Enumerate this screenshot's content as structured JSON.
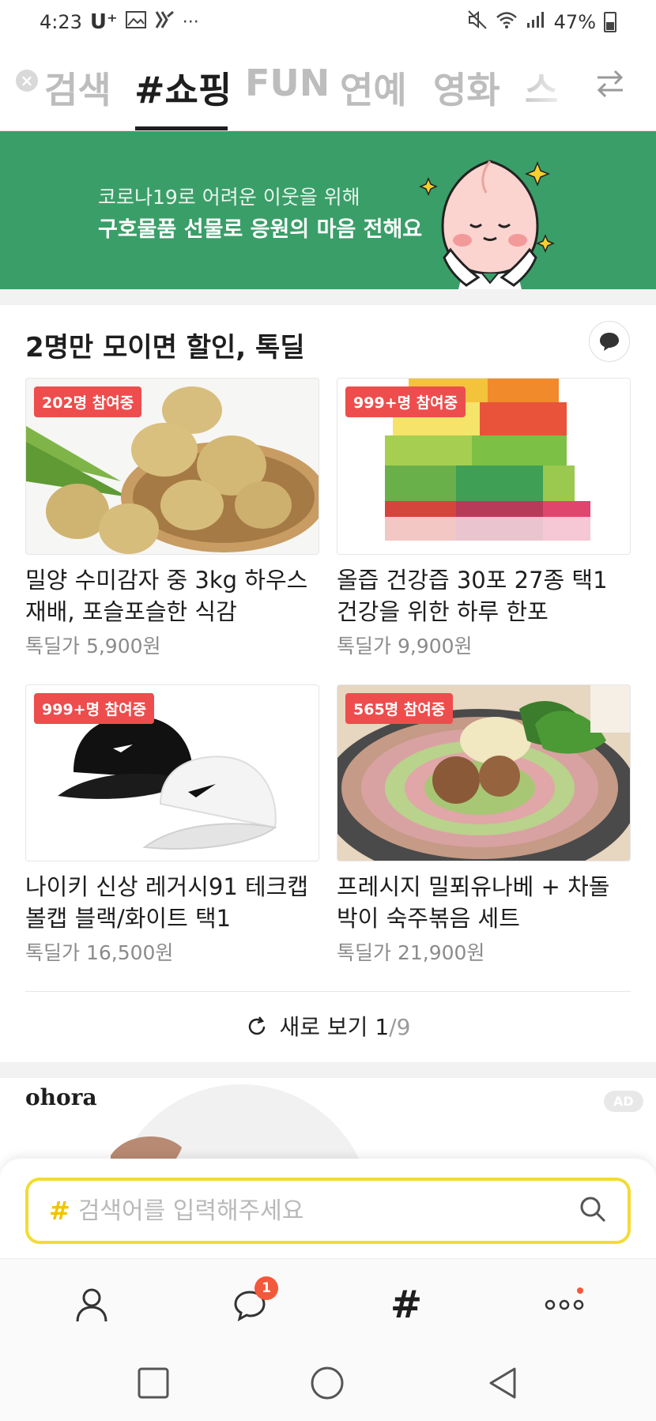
{
  "status_bar": {
    "time": "4:23",
    "carrier": "U⁺",
    "dots": "···",
    "battery": "47%"
  },
  "tabs": {
    "items": [
      "검색",
      "#쇼핑",
      "FUN",
      "연예",
      "영화",
      "스"
    ],
    "active": "#쇼핑",
    "clear_icon": "×"
  },
  "banner": {
    "line1": "코로나19로 어려운 이웃을 위해",
    "line2": "구호물품 선물로 응원의 마음 전해요",
    "bg_color": "#3a9e68"
  },
  "section": {
    "title": "2명만 모이면 할인, 톡딜"
  },
  "products": [
    {
      "badge": "202명 참여중",
      "name": "밀양 수미감자 중 3kg 하우스 재배, 포슬포슬한 식감",
      "price": "톡딜가 5,900원"
    },
    {
      "badge": "999+명 참여중",
      "name": "올즙 건강즙 30포 27종 택1 건강을 위한 하루 한포",
      "price": "톡딜가 9,900원"
    },
    {
      "badge": "999+명 참여중",
      "name": "나이키 신상 레거시91 테크캡  볼캡 블랙/화이트 택1",
      "price": "톡딜가 16,500원"
    },
    {
      "badge": "565명 참여중",
      "name": "프레시지 밀푀유나베 + 차돌박이 숙주볶음 세트",
      "price": "톡딜가 21,900원"
    }
  ],
  "refresh": {
    "label": "새로 보기",
    "page_current": "1",
    "page_total": "/9"
  },
  "ad": {
    "brand": "ohora",
    "badge": "AD"
  },
  "search": {
    "hash": "#",
    "placeholder": "검색어를 입력해주세요"
  },
  "bottom_nav": {
    "chat_badge": "1",
    "hash": "#"
  },
  "colors": {
    "accent_yellow": "#f2dc33",
    "badge_red": "#ee4d4d"
  }
}
